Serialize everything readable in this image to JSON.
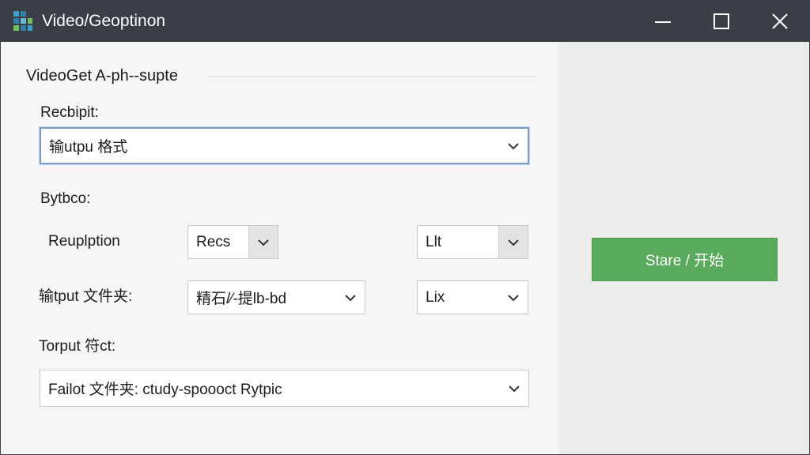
{
  "window": {
    "title": "Video/Geoptinon",
    "controls": {
      "minimize": "minimize",
      "maximize": "maximize",
      "close": "close"
    }
  },
  "group": {
    "title": "VideoGet A-ph--supte"
  },
  "fields": {
    "recbipit_label": "Recbipit:",
    "output_format_value": "输utpu 格式",
    "bytbco_label": "Bytbco:",
    "reuplption_label": "Reuplption",
    "reuplption_value": "Recs",
    "reuplption_extra_value": "Llt",
    "output_folder_label": "输tput 文件夹:",
    "output_folder_value": "精石/⁄-提lb-bd",
    "output_folder_extra_value": "Lix",
    "torput_label": "Torput 符ct:",
    "failot_value": "Failot 文件夹:  ctudy-spoooct Rytpic"
  },
  "actions": {
    "start_label": "Stare / 开始"
  },
  "colors": {
    "titlebar": "#3a3e46",
    "start_button": "#5aaa5c",
    "focus_border": "#7a9cc6"
  },
  "icons": {
    "app": "app-grid-icon",
    "dropdown": "chevron-down-icon"
  }
}
